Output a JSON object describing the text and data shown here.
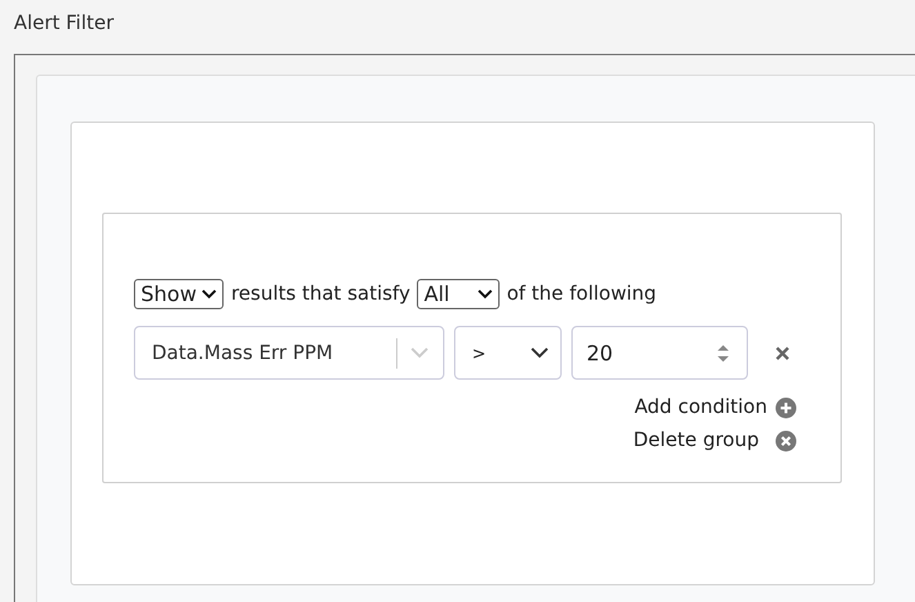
{
  "window": {
    "title": "Alert Filter"
  },
  "rule": {
    "mode": "Show",
    "text_1": "results that satisfy",
    "quantifier": "All",
    "text_2": "of the following"
  },
  "condition": {
    "field": "Data.Mass Err PPM",
    "operator": ">",
    "value": "20"
  },
  "actions": [
    {
      "kind": "add",
      "label": "Add condition"
    },
    {
      "kind": "delete",
      "label": "Delete group"
    }
  ]
}
